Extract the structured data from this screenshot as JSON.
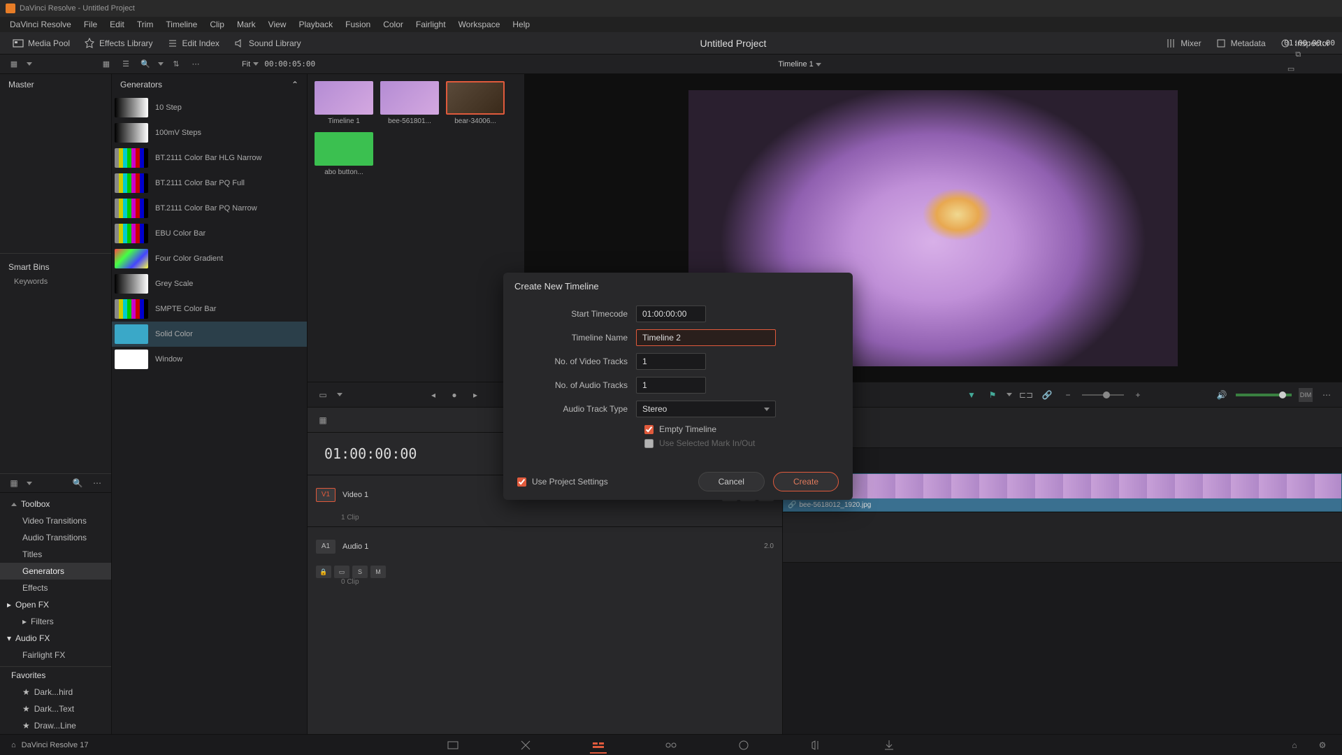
{
  "titlebar": "DaVinci Resolve - Untitled Project",
  "menubar": [
    "DaVinci Resolve",
    "File",
    "Edit",
    "Trim",
    "Timeline",
    "Clip",
    "Mark",
    "View",
    "Playback",
    "Fusion",
    "Color",
    "Fairlight",
    "Workspace",
    "Help"
  ],
  "toolbar": {
    "media_pool": "Media Pool",
    "effects_library": "Effects Library",
    "edit_index": "Edit Index",
    "sound_library": "Sound Library",
    "mixer": "Mixer",
    "metadata": "Metadata",
    "inspector": "Inspector"
  },
  "project_title": "Untitled Project",
  "subtoolbar": {
    "fit": "Fit",
    "timecode": "00:00:05:00",
    "timeline_name": "Timeline 1",
    "right_timecode": "01:00:00:00"
  },
  "media_pool_header": "Master",
  "smart_bins": {
    "header": "Smart Bins",
    "items": [
      "Keywords"
    ]
  },
  "media_thumbs": [
    {
      "label": "Timeline 1",
      "type": "flower"
    },
    {
      "label": "bee-561801...",
      "type": "flower"
    },
    {
      "label": "bear-34006...",
      "type": "bear",
      "selected": true
    },
    {
      "label": "abo button...",
      "type": "green"
    }
  ],
  "toolbox": {
    "header": "Toolbox",
    "items": [
      "Video Transitions",
      "Audio Transitions",
      "Titles",
      "Generators",
      "Effects"
    ],
    "selected": "Generators",
    "openfx": "Open FX",
    "filters": "Filters",
    "audiofx": "Audio FX",
    "fairlightfx": "Fairlight FX"
  },
  "favorites": {
    "header": "Favorites",
    "items": [
      "Dark...hird",
      "Dark...Text",
      "Draw...Line"
    ]
  },
  "generators": {
    "header": "Generators",
    "items": [
      {
        "label": "10 Step",
        "thumb": "step"
      },
      {
        "label": "100mV Steps",
        "thumb": "step"
      },
      {
        "label": "BT.2111 Color Bar HLG Narrow",
        "thumb": "bars"
      },
      {
        "label": "BT.2111 Color Bar PQ Full",
        "thumb": "bars"
      },
      {
        "label": "BT.2111 Color Bar PQ Narrow",
        "thumb": "bars"
      },
      {
        "label": "EBU Color Bar",
        "thumb": "bars"
      },
      {
        "label": "Four Color Gradient",
        "thumb": "gradient"
      },
      {
        "label": "Grey Scale",
        "thumb": "grey"
      },
      {
        "label": "SMPTE Color Bar",
        "thumb": "bars"
      },
      {
        "label": "Solid Color",
        "thumb": "solid",
        "selected": true
      },
      {
        "label": "Window",
        "thumb": "window"
      }
    ]
  },
  "timeline": {
    "timecode": "01:00:00:00",
    "video_track": {
      "badge": "V1",
      "name": "Video 1",
      "clips": "1 Clip"
    },
    "audio_track": {
      "badge": "A1",
      "name": "Audio 1",
      "meter": "2.0",
      "clips": "0 Clip"
    },
    "clip_name": "bee-5618012_1920.jpg"
  },
  "dialog": {
    "title": "Create New Timeline",
    "start_timecode_label": "Start Timecode",
    "start_timecode": "01:00:00:00",
    "timeline_name_label": "Timeline Name",
    "timeline_name": "Timeline 2",
    "video_tracks_label": "No. of Video Tracks",
    "video_tracks": "1",
    "audio_tracks_label": "No. of Audio Tracks",
    "audio_tracks": "1",
    "audio_type_label": "Audio Track Type",
    "audio_type": "Stereo",
    "empty_timeline": "Empty Timeline",
    "use_mark": "Use Selected Mark In/Out",
    "use_project_settings": "Use Project Settings",
    "cancel": "Cancel",
    "create": "Create"
  },
  "appname": "DaVinci Resolve 17"
}
